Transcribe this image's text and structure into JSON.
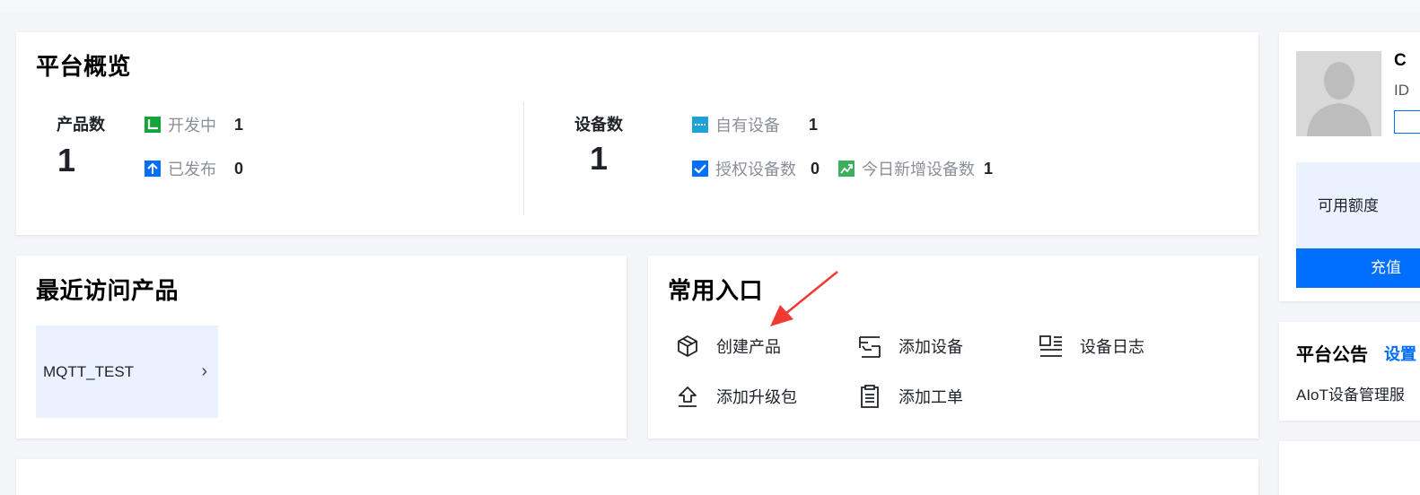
{
  "overview": {
    "title": "平台概览",
    "products": {
      "label": "产品数",
      "total": "1",
      "developing": {
        "label": "开发中",
        "value": "1",
        "color": "#13a538"
      },
      "published": {
        "label": "已发布",
        "value": "0",
        "color": "#006eff"
      }
    },
    "devices": {
      "label": "设备数",
      "total": "1",
      "own": {
        "label": "自有设备",
        "value": "1",
        "color": "#1ea2d6"
      },
      "authorized": {
        "label": "授权设备数",
        "value": "0",
        "color": "#006eff"
      },
      "new_today": {
        "label": "今日新增设备数",
        "value": "1",
        "color": "#3eaf5c"
      }
    }
  },
  "recent": {
    "title": "最近访问产品",
    "items": [
      {
        "label": "MQTT_TEST",
        "chevron": "›"
      }
    ]
  },
  "shortcuts": {
    "title": "常用入口",
    "items": [
      {
        "label": "创建产品",
        "icon": "cube-icon"
      },
      {
        "label": "添加设备",
        "icon": "add-device-icon"
      },
      {
        "label": "设备日志",
        "icon": "device-log-icon"
      },
      {
        "label": "添加升级包",
        "icon": "upload-icon"
      },
      {
        "label": "添加工单",
        "icon": "clipboard-icon"
      }
    ],
    "annotation_color": "#f23a32"
  },
  "account": {
    "name_initial": "C",
    "id_label": "ID",
    "quota_label": "可用额度",
    "recharge_label": "充值"
  },
  "notice": {
    "title": "平台公告",
    "link": "设置",
    "text": "AIoT设备管理服"
  }
}
